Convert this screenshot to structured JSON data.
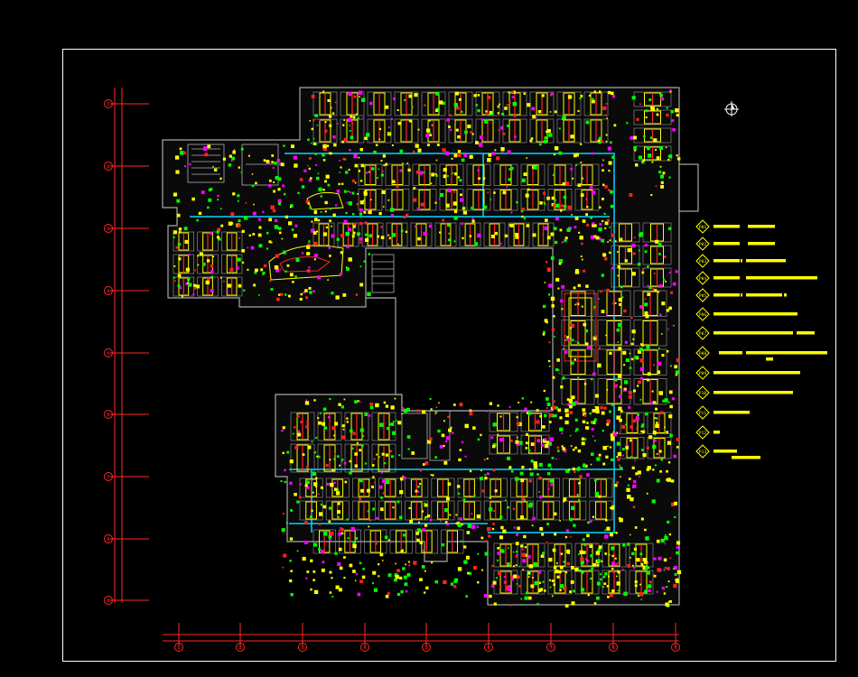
{
  "drawing": {
    "background_color": "#000000",
    "frame_color": "#ffffff",
    "layer_colors": {
      "walls": "#b0b0b0",
      "dimension": "#ff2a2a",
      "fixtures": "#ffff00",
      "power": "#ff2222",
      "data": "#00ff00",
      "cable_tray": "#00d8ff",
      "equipment": "#ff00ff",
      "legend": "#ffff00"
    },
    "north_arrow_icon": "compass-rose-icon"
  },
  "vertical_axes": [
    "①",
    "②",
    "③",
    "④",
    "⑤",
    "⑥",
    "⑦",
    "⑧",
    "⑨"
  ],
  "horizontal_axes": [
    "①",
    "②",
    "③",
    "④",
    "⑤",
    "⑥",
    "⑦",
    "⑧",
    "⑨"
  ],
  "legend": {
    "codes": [
      "P01",
      "P02",
      "P03",
      "P04",
      "P05",
      "P06",
      "P07",
      "P08",
      "P09",
      "P10",
      "P11",
      "P12",
      "P13"
    ],
    "icon": "diamond-tag-icon"
  }
}
